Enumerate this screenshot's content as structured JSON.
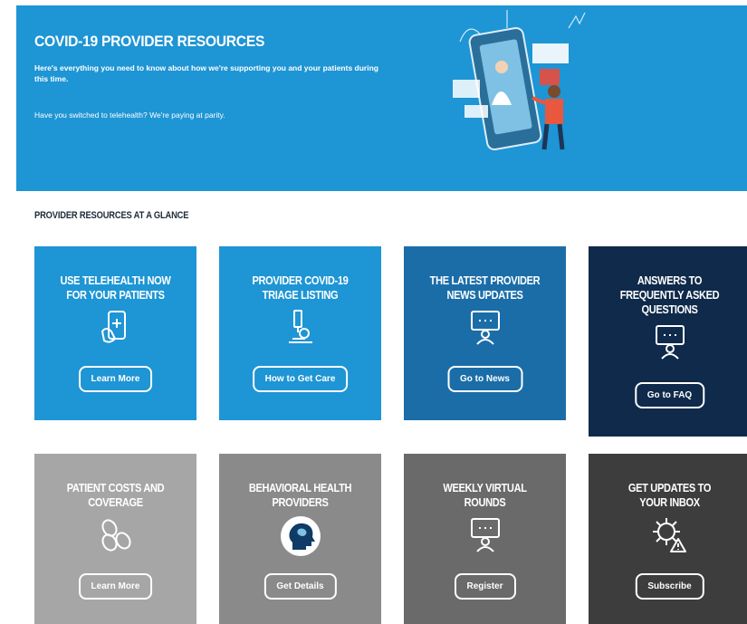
{
  "hero": {
    "title": "COVID-19 PROVIDER RESOURCES",
    "description": "Here's everything you need to know about how we're supporting you and your patients during this time.",
    "telehealth_note": "Have you switched to telehealth? We're paying at parity."
  },
  "section_title": "PROVIDER RESOURCES AT A GLANCE",
  "tiles": [
    {
      "title": "USE TELEHEALTH NOW\nFOR YOUR PATIENTS",
      "button": "Learn More",
      "icon": "tablet-medical-icon",
      "color": "#1e95d4"
    },
    {
      "title": "PROVIDER COVID-19\nTRIAGE LISTING",
      "button": "How to Get Care",
      "icon": "microscope-icon",
      "color": "#1e95d4"
    },
    {
      "title": "THE LATEST PROVIDER\nNEWS UPDATES",
      "button": "Go to News",
      "icon": "presenter-icon",
      "color": "#1b6da8"
    },
    {
      "title": "ANSWERS TO\nFREQUENTLY ASKED\nQUESTIONS",
      "button": "Go to FAQ",
      "icon": "presenter-icon",
      "color": "#0f2a4a"
    },
    {
      "title": "PATIENT COSTS AND\nCOVERAGE",
      "button": "Learn More",
      "icon": "coins-icon",
      "color": "#a6a6a6"
    },
    {
      "title": "BEHAVIORAL HEALTH\nPROVIDERS",
      "button": "Get Details",
      "icon": "brain-head-icon",
      "color": "#8a8a8a"
    },
    {
      "title": "WEEKLY VIRTUAL\nROUNDS",
      "button": "Register",
      "icon": "presenter-icon",
      "color": "#6a6a6a"
    },
    {
      "title": "GET UPDATES TO\nYOUR INBOX",
      "button": "Subscribe",
      "icon": "virus-alert-icon",
      "color": "#3d3d3d"
    }
  ]
}
